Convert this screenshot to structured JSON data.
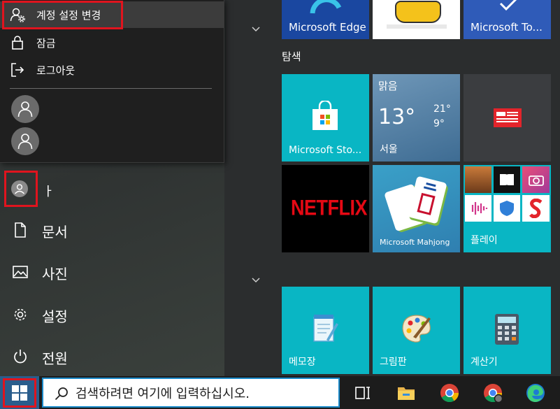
{
  "account_menu": {
    "change_settings": "계정 설정 변경",
    "lock": "잠금",
    "sign_out": "로그아웃"
  },
  "current_user": {
    "name_fragment": "ㅏ"
  },
  "left_nav": [
    {
      "label": "문서",
      "icon": "document-icon"
    },
    {
      "label": "사진",
      "icon": "pictures-icon"
    },
    {
      "label": "설정",
      "icon": "gear-icon"
    },
    {
      "label": "전원",
      "icon": "power-icon"
    }
  ],
  "groups": {
    "explore": "탐색"
  },
  "tiles": {
    "edge": "Microsoft Edge",
    "todo": "Microsoft To...",
    "store": "Microsoft Sto...",
    "weather": {
      "condition": "맑음",
      "temp": "13°",
      "high": "21°",
      "low": "9°",
      "city": "서울"
    },
    "netflix": "NETFLIX",
    "mahjong": "Microsoft Mahjong",
    "play": "플레이",
    "notepad": "메모장",
    "paint": "그림판",
    "calculator": "계산기"
  },
  "taskbar": {
    "search_placeholder": "검색하려면 여기에 입력하십시오.",
    "pinned": [
      "task-view-icon",
      "file-explorer-icon",
      "chrome-icon",
      "chrome-profile-icon",
      "edge-icon"
    ]
  },
  "colors": {
    "tile_teal": "#09b6c4",
    "highlight_red": "#e0141e",
    "start_blue": "#2a5d8c"
  }
}
